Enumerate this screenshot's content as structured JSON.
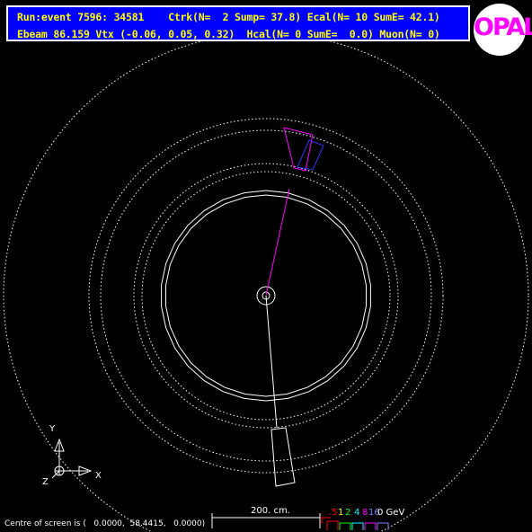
{
  "header": {
    "line1": "Run:event 7596: 34581    Ctrk(N=  2 Sump= 37.8) Ecal(N= 10 SumE= 42.1)",
    "line2": "Ebeam 86.159 Vtx (-0.06, 0.05, 0.32)  Hcal(N= 0 SumE=  0.0) Muon(N= 0)"
  },
  "logo": {
    "text": "OPAL"
  },
  "axes": {
    "y": "Y",
    "x": "X",
    "z": "Z"
  },
  "scale": {
    "label": "200. cm."
  },
  "energy_legend": {
    "items": [
      {
        "text": ".5",
        "color": "#ff0000"
      },
      {
        "text": "1",
        "color": "#ffff00"
      },
      {
        "text": "2",
        "color": "#00ff00"
      },
      {
        "text": "4",
        "color": "#00ffff"
      },
      {
        "text": "8",
        "color": "#ff00ff"
      },
      {
        "text": "16",
        "color": "#8080ff"
      }
    ],
    "unit": "0 GeV"
  },
  "status": {
    "text": "Centre of screen is (   0.0000,  58.4415,   0.0000)"
  }
}
